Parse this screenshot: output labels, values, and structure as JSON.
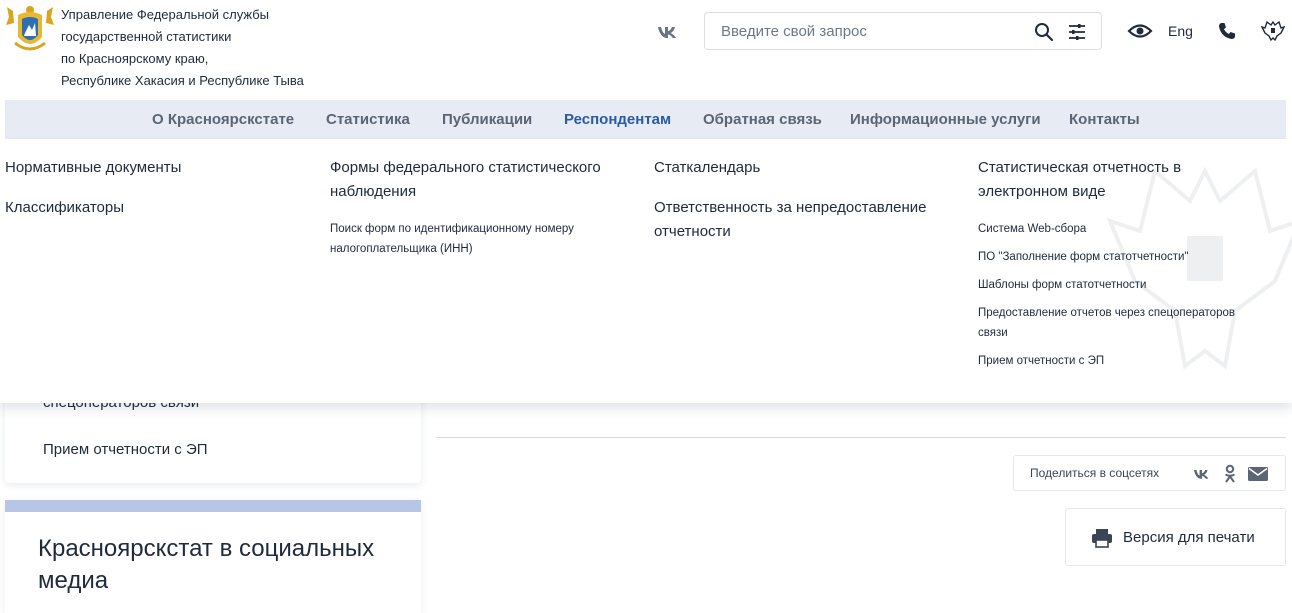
{
  "header": {
    "org_name_lines": [
      "Управление Федеральной службы",
      "государственной статистики",
      "по Красноярскому краю,",
      "Республике Хакасия и Республике Тыва"
    ],
    "logo_icon": "rosstat-emblem-icon",
    "social_icon": "vk-icon",
    "search": {
      "placeholder": "Введите свой запрос",
      "value": "",
      "search_icon": "search-icon",
      "filter_icon": "filter-sliders-icon"
    },
    "accessibility_icon": "eye-icon",
    "lang_label": "Eng",
    "phone_icon": "phone-icon",
    "emblem_icon": "coat-of-arms-icon"
  },
  "nav": {
    "items": [
      {
        "label": "О Красноярскстате"
      },
      {
        "label": "Статистика"
      },
      {
        "label": "Публикации"
      },
      {
        "label": "Респондентам",
        "active": true
      },
      {
        "label": "Обратная связь"
      },
      {
        "label": "Информационные услуги"
      },
      {
        "label": "Контакты"
      }
    ]
  },
  "dropdown": {
    "col1": {
      "links": [
        "Нормативные документы",
        "Классификаторы"
      ]
    },
    "col2": {
      "title_lines": [
        "Формы федерального статистического",
        "наблюдения"
      ],
      "sub_lines": [
        "Поиск форм по идентификационному номеру",
        "налогоплательщика (ИНН)"
      ]
    },
    "col3": {
      "link1": "Статкалендарь",
      "link2_lines": [
        "Ответственность за непредоставление",
        "отчетности"
      ]
    },
    "col4": {
      "title_lines": [
        "Статистическая отчетность в",
        "электронном виде"
      ],
      "sub": [
        "Система Web-сбора",
        "ПО \"Заполнение форм статотчетности\"",
        "Шаблоны форм статотчетности",
        "Предоставление отчетов через спецоператоров",
        "связи",
        "Прием отчетности с ЭП"
      ]
    }
  },
  "sidebar": {
    "partial_item": "спецоператоров связи",
    "item_last": "Прием отчетности с ЭП",
    "social_title": "Красноярскстат в социальных медиа"
  },
  "share": {
    "label": "Поделиться в соцсетях",
    "icons": [
      "vk-icon",
      "odnoklassniki-icon",
      "mail-icon"
    ]
  },
  "print": {
    "label": "Версия для печати",
    "icon": "printer-icon"
  },
  "colors": {
    "nav_bg": "#e7ecf4",
    "active": "#2b5aa8",
    "text": "#1f2a3c",
    "accent_bar": "#b6c6e4"
  }
}
